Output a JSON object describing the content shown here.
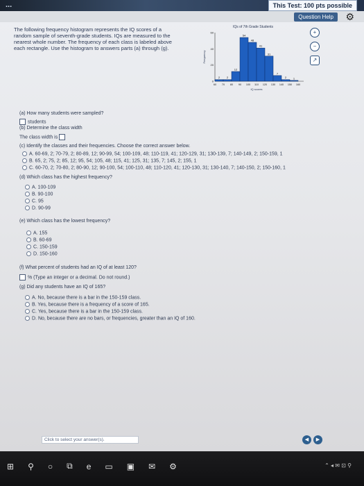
{
  "window": {
    "title": "...",
    "tabs": [
      "This Test: 100 pts possible",
      "",
      ""
    ]
  },
  "header": {
    "question_help": "Question Help"
  },
  "intro": "The following frequency histogram represents the IQ scores of a random sample of seventh-grade students. IQs are measured to the nearest whole number. The frequency of each class is labeled above each rectangle. Use the histogram to answers parts (a) through (g).",
  "chart_data": {
    "type": "bar",
    "title": "IQs of 7th Grade Students",
    "xlabel": "IQ scores",
    "ylabel": "Frequency",
    "categories": [
      "60",
      "70",
      "80",
      "90",
      "100",
      "110",
      "120",
      "130",
      "140",
      "150",
      "160"
    ],
    "values": [
      2,
      2,
      12,
      54,
      48,
      41,
      31,
      7,
      2,
      1
    ],
    "bar_labels": [
      "2",
      "2",
      "12",
      "54",
      "48",
      "41",
      "31",
      "7",
      "2",
      "1"
    ],
    "yticks": [
      "0",
      "20",
      "40",
      "60"
    ],
    "ylim": [
      0,
      60
    ],
    "colors": {
      "bar": "#1f5fbf",
      "border": "#0b2e6b"
    }
  },
  "questions": {
    "a": {
      "text": "(a) How many students were sampled?",
      "suffix": "students"
    },
    "b": {
      "text": "(b) Determine the class width",
      "answer_prefix": "The class width is"
    },
    "c": {
      "text": "(c) Identify the classes and their frequencies. Choose the correct answer below.",
      "options": [
        "A. 60-69, 2; 70-79, 2; 80-89, 12; 90-99, 54; 100-109, 48; 110-119, 41; 120-129, 31; 130-139, 7; 140-149, 2; 150-159, 1",
        "B. 65, 2; 75, 2; 85, 12; 95, 54; 105, 48; 115, 41; 125, 31; 135, 7; 145, 2; 155, 1",
        "C. 60-70, 2; 70-80, 2; 80-90, 12; 90-100, 54; 100-110, 48; 110-120, 41; 120-130, 31; 130-140, 7; 140-150, 2; 150-160, 1"
      ]
    },
    "d": {
      "text": "(d) Which class has the highest frequency?",
      "options": [
        "A. 100-109",
        "B. 90-100",
        "C. 95",
        "D. 90-99"
      ]
    },
    "e": {
      "text": "(e) Which class has the lowest frequency?",
      "options": [
        "A. 155",
        "B. 60-69",
        "C. 150-159",
        "D. 150-160"
      ]
    },
    "f": {
      "text": "(f) What percent of students had an IQ of at least 120?",
      "hint": "% (Type an integer or a decimal. Do not round.)"
    },
    "g": {
      "text": "(g) Did any students have an IQ of 165?",
      "options": [
        "A. No, because there is a bar in the 150-159 class.",
        "B. Yes, because there is a frequency of a score of 165.",
        "C. Yes, because there is a bar in the 150-159 class.",
        "D. No, because there are no bars, or frequencies, greater than an IQ of 160."
      ]
    }
  },
  "footer": {
    "prompt": "Click to select your answer(s)."
  },
  "taskbar": {
    "tray": "⌃ ◂ ✉ ⊡ ⚲"
  }
}
